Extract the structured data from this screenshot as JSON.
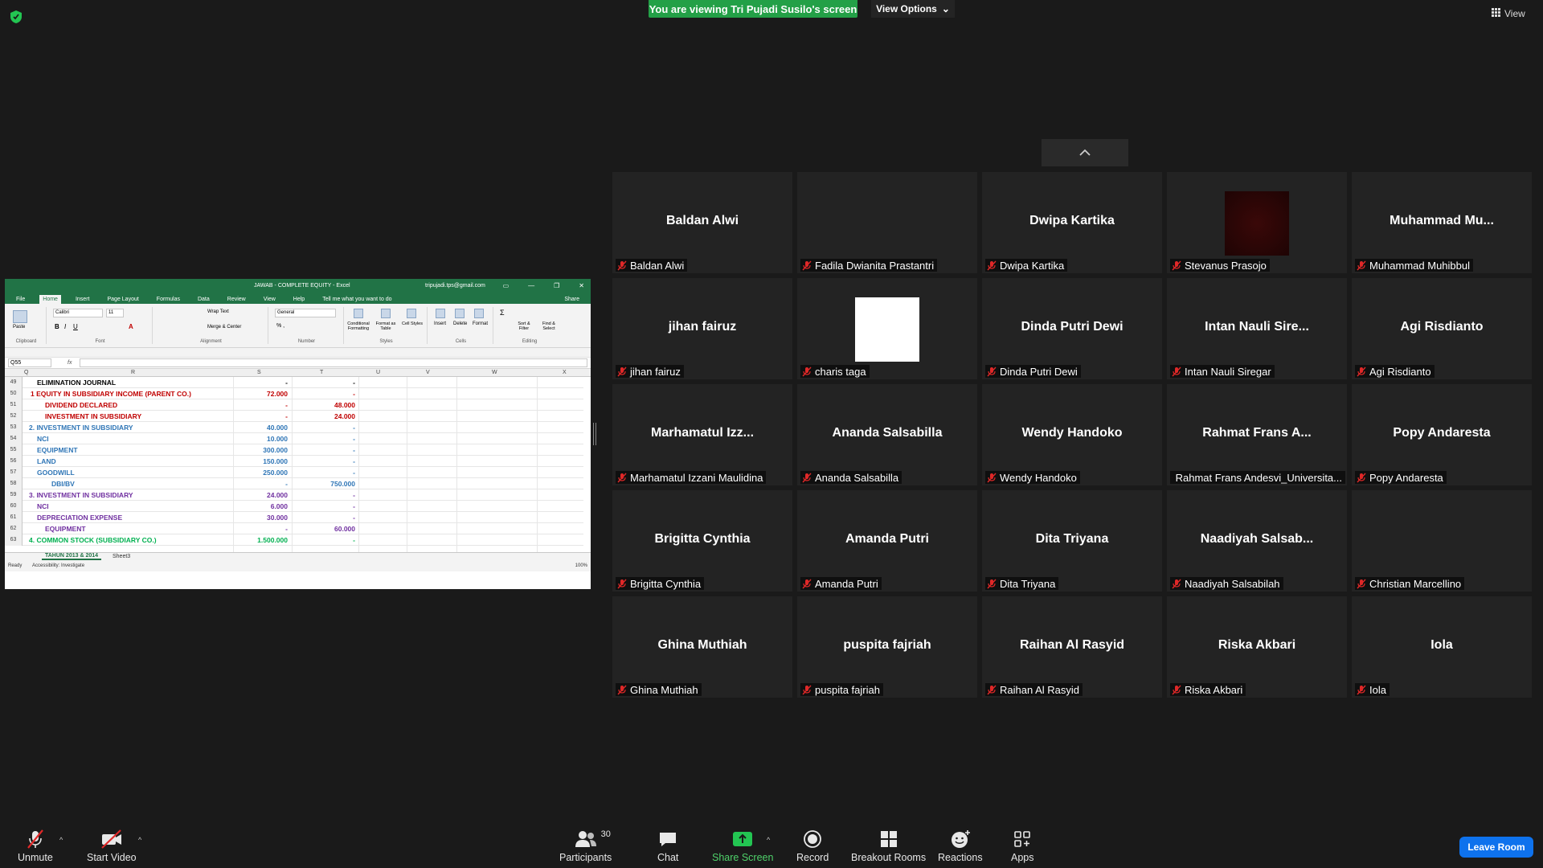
{
  "top": {
    "banner": "You are viewing Tri Pujadi Susilo's screen",
    "view_options": "View Options",
    "view_label": "View"
  },
  "excel": {
    "title": "JAWAB - COMPLETE EQUITY  -  Excel",
    "account": "tripujadi.tps@gmail.com",
    "tabs": [
      "File",
      "Home",
      "Insert",
      "Page Layout",
      "Formulas",
      "Data",
      "Review",
      "View",
      "Help"
    ],
    "tell_me": "Tell me what you want to do",
    "share": "Share",
    "ribbon": {
      "paste": "Paste",
      "font_name": "Calibri",
      "font_size": "11",
      "wrap_text": "Wrap Text",
      "merge_center": "Merge & Center",
      "number_format": "General",
      "conditional": "Conditional Formatting",
      "format_table": "Format as Table",
      "cell_styles": "Cell Styles",
      "insert": "Insert",
      "delete": "Delete",
      "format": "Format",
      "sort_filter": "Sort & Filter",
      "find_select": "Find & Select",
      "groups": [
        "Clipboard",
        "Font",
        "Alignment",
        "Number",
        "Styles",
        "Cells",
        "Editing"
      ]
    },
    "name_box": "Q55",
    "fx": "fx",
    "columns": [
      "Q",
      "R",
      "S",
      "T",
      "U",
      "V",
      "W",
      "X"
    ],
    "rows": [
      {
        "n": "49",
        "label": "ELIMINATION JOURNAL",
        "s": "-",
        "t": "-",
        "color": "#000000",
        "indent": 0
      },
      {
        "n": "50",
        "label": "1  EQUITY IN SUBSIDIARY INCOME  (PARENT CO.)",
        "s": "72.000",
        "t": "-",
        "color": "#c00000",
        "indent": -8
      },
      {
        "n": "51",
        "label": "DIVIDEND DECLARED",
        "s": "-",
        "t": "48.000",
        "color": "#c00000",
        "indent": 10
      },
      {
        "n": "52",
        "label": "INVESTMENT IN SUBSIDIARY",
        "s": "-",
        "t": "24.000",
        "color": "#c00000",
        "indent": 10
      },
      {
        "n": "53",
        "label": "2. INVESTMENT IN SUBSIDIARY",
        "s": "40.000",
        "t": "-",
        "color": "#2e75b6",
        "indent": -10
      },
      {
        "n": "54",
        "label": "NCI",
        "s": "10.000",
        "t": "-",
        "color": "#2e75b6",
        "indent": 0
      },
      {
        "n": "55",
        "label": "EQUIPMENT",
        "s": "300.000",
        "t": "-",
        "color": "#2e75b6",
        "indent": 0
      },
      {
        "n": "56",
        "label": "LAND",
        "s": "150.000",
        "t": "-",
        "color": "#2e75b6",
        "indent": 0
      },
      {
        "n": "57",
        "label": "GOODWILL",
        "s": "250.000",
        "t": "-",
        "color": "#2e75b6",
        "indent": 0
      },
      {
        "n": "58",
        "label": "DBI/BV",
        "s": "-",
        "t": "750.000",
        "color": "#2e75b6",
        "indent": 18
      },
      {
        "n": "59",
        "label": "3. INVESTMENT IN SUBSIDIARY",
        "s": "24.000",
        "t": "-",
        "color": "#7030a0",
        "indent": -10
      },
      {
        "n": "60",
        "label": "NCI",
        "s": "6.000",
        "t": "-",
        "color": "#7030a0",
        "indent": 0
      },
      {
        "n": "61",
        "label": "DEPRECIATION EXPENSE",
        "s": "30.000",
        "t": "-",
        "color": "#7030a0",
        "indent": 0
      },
      {
        "n": "62",
        "label": "EQUIPMENT",
        "s": "-",
        "t": "60.000",
        "color": "#7030a0",
        "indent": 10
      },
      {
        "n": "63",
        "label": "4. COMMON STOCK (SUBSIDIARY CO.)",
        "s": "1.500.000",
        "t": "-",
        "color": "#00b050",
        "indent": -10
      }
    ],
    "sheets": [
      "TAHUN 2013 & 2014",
      "Sheet3"
    ],
    "status_ready": "Ready",
    "accessibility": "Accessibility: Investigate",
    "zoom": "100%"
  },
  "tiles": [
    {
      "big": "Baldan Alwi",
      "name": "Baldan Alwi",
      "thumb": ""
    },
    {
      "big": "",
      "name": "Fadila Dwianita Prastantri",
      "thumb": ""
    },
    {
      "big": "Dwipa Kartika",
      "name": "Dwipa Kartika",
      "thumb": ""
    },
    {
      "big": "",
      "name": "Stevanus Prasojo",
      "thumb": "dark"
    },
    {
      "big": "Muhammad  Mu...",
      "name": "Muhammad Muhibbul",
      "thumb": ""
    },
    {
      "big": "jihan fairuz",
      "name": "jihan fairuz",
      "thumb": ""
    },
    {
      "big": "",
      "name": "charis taga",
      "thumb": "light"
    },
    {
      "big": "Dinda Putri Dewi",
      "name": "Dinda Putri Dewi",
      "thumb": ""
    },
    {
      "big": "Intan  Nauli  Sire...",
      "name": "Intan Nauli Siregar",
      "thumb": ""
    },
    {
      "big": "Agi Risdianto",
      "name": "Agi Risdianto",
      "thumb": ""
    },
    {
      "big": "Marhamatul  Izz...",
      "name": "Marhamatul Izzani Maulidina",
      "thumb": ""
    },
    {
      "big": "Ananda Salsabilla",
      "name": "Ananda Salsabilla",
      "thumb": ""
    },
    {
      "big": "Wendy Handoko",
      "name": "Wendy Handoko",
      "thumb": ""
    },
    {
      "big": "Rahmat Frans A...",
      "name": "Rahmat Frans Andesvi_Universita...",
      "thumb": ""
    },
    {
      "big": "Popy Andaresta",
      "name": "Popy Andaresta",
      "thumb": ""
    },
    {
      "big": "Brigitta Cynthia",
      "name": "Brigitta Cynthia",
      "thumb": ""
    },
    {
      "big": "Amanda Putri",
      "name": "Amanda Putri",
      "thumb": ""
    },
    {
      "big": "Dita Triyana",
      "name": "Dita Triyana",
      "thumb": ""
    },
    {
      "big": "Naadiyah  Salsab...",
      "name": "Naadiyah Salsabilah",
      "thumb": ""
    },
    {
      "big": "",
      "name": "Christian Marcellino",
      "thumb": ""
    },
    {
      "big": "Ghina Muthiah",
      "name": "Ghina Muthiah",
      "thumb": ""
    },
    {
      "big": "puspita fajriah",
      "name": "puspita fajriah",
      "thumb": ""
    },
    {
      "big": "Raihan Al Rasyid",
      "name": "Raihan Al Rasyid",
      "thumb": ""
    },
    {
      "big": "Riska Akbari",
      "name": "Riska Akbari",
      "thumb": ""
    },
    {
      "big": "Iola",
      "name": "Iola",
      "thumb": ""
    }
  ],
  "toolbar": {
    "unmute": "Unmute",
    "start_video": "Start Video",
    "participants": "Participants",
    "participants_count": "30",
    "chat": "Chat",
    "share_screen": "Share Screen",
    "record": "Record",
    "breakout": "Breakout Rooms",
    "reactions": "Reactions",
    "apps": "Apps",
    "leave": "Leave Room"
  },
  "colors": {
    "banner_green": "#23a047",
    "excel_green": "#217346",
    "leave_blue": "#0e72ed",
    "mute_red": "#e02828"
  }
}
